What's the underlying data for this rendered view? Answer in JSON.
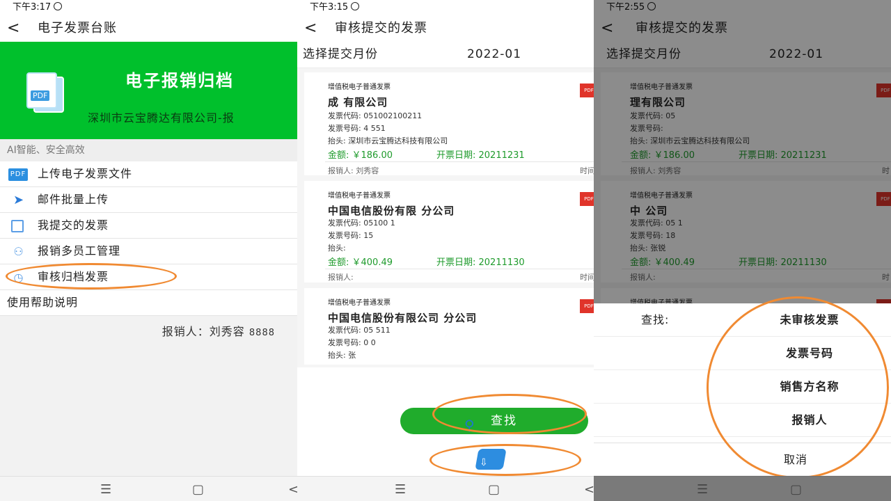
{
  "panel1": {
    "status_time": "下午3:17",
    "title": "电子发票台账",
    "banner_icon_label": "PDF",
    "banner_title": "电子报销归档",
    "banner_company": "深圳市云宝腾达有限公司-报",
    "subtitle": "AI智能、安全高效",
    "menu": [
      {
        "label": "上传电子发票文件",
        "icon": "pdf-icon",
        "icon_text": "PDF"
      },
      {
        "label": "邮件批量上传",
        "icon": "send-icon"
      },
      {
        "label": "我提交的发票",
        "icon": "document-icon"
      },
      {
        "label": "报销多员工管理",
        "icon": "users-icon"
      },
      {
        "label": "审核归档发票",
        "icon": "audit-icon"
      },
      {
        "label": "使用帮助说明"
      }
    ],
    "reporter_label": "报销人：",
    "reporter_name": "刘秀容",
    "reporter_id": "8888"
  },
  "panel2": {
    "status_time": "下午3:15",
    "title": "审核提交的发票",
    "month_label": "选择提交月份",
    "month_value": "2022-01",
    "cards": [
      {
        "tag": "增值税电子普通发票",
        "pdf": "PDF",
        "name": "成                    有限公司",
        "code": "发票代码: 051002100211",
        "number": "发票号码: 4        551",
        "header": "抬头: 深圳市云宝腾达科技有限公司",
        "amount": "金额: ￥186.00",
        "date": "开票日期: 20211231",
        "reporter": "报销人: 刘秀容",
        "time": "时间"
      },
      {
        "tag": "增值税电子普通发票",
        "pdf": "PDF",
        "name": "中国电信股份有限         分公司",
        "code": "发票代码: 05100        1",
        "number": "发票号码: 15",
        "header": "抬头:",
        "amount": "金额: ￥400.49",
        "date": "开票日期: 20211130",
        "reporter": "报销人:",
        "time": "时间"
      },
      {
        "tag": "增值税电子普通发票",
        "pdf": "PDF",
        "name": "中国电信股份有限公司         分公司",
        "code": "发票代码: 05        511",
        "number": "发票号码: 0        0",
        "header": "抬头: 张"
      }
    ],
    "search_label": "查找"
  },
  "panel3": {
    "status_time": "下午2:55",
    "title": "审核提交的发票",
    "month_label": "选择提交月份",
    "month_value": "2022-01",
    "cards": [
      {
        "tag": "增值税电子普通发票",
        "pdf": "PDF",
        "name": "       理有限公司",
        "code": "发票代码: 05",
        "number": "发票号码:",
        "header": "抬头: 深圳市云宝腾达科技有限公司",
        "amount": "金额: ￥186.00",
        "date": "开票日期: 20211231",
        "reporter": "报销人: 刘秀容",
        "time": "时"
      },
      {
        "tag": "增值税电子普通发票",
        "pdf": "PDF",
        "name": "中                          公司",
        "code": "发票代码: 05       1",
        "number": "发票号码: 18",
        "header": "抬头: 张锐",
        "amount": "金额: ￥400.49",
        "date": "开票日期: 20211130",
        "reporter": "报销人:",
        "time": "时"
      },
      {
        "tag": "增值税电子普通发票",
        "pdf": "PDF"
      }
    ],
    "sheet": {
      "find_label": "查找:",
      "options": [
        "未审核发票",
        "发票号码",
        "销售方名称",
        "报销人"
      ],
      "cancel": "取消"
    }
  },
  "colors": {
    "brand_green": "#00c02c",
    "amount_green": "#1f9b2c",
    "highlight_orange": "#f08a32",
    "pdf_red": "#e0342a"
  }
}
